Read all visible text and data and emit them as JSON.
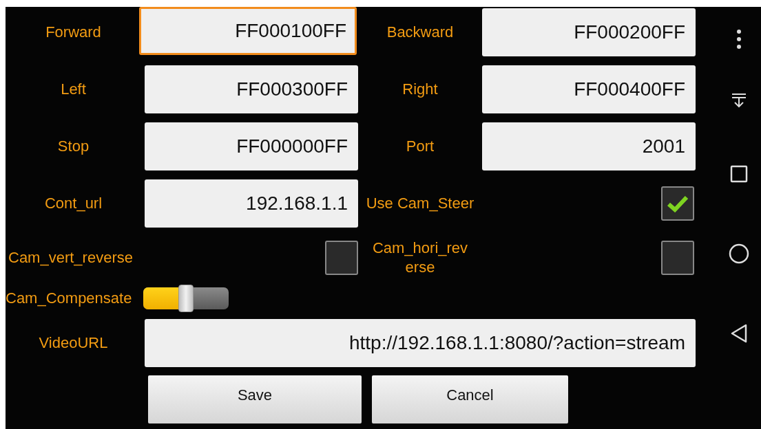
{
  "settings": [
    {
      "kind": "text",
      "label": "Forward",
      "value": "FF000100FF",
      "focused": true
    },
    {
      "kind": "text",
      "label": "Backward",
      "value": "FF000200FF",
      "focused": false
    },
    {
      "kind": "text",
      "label": "Left",
      "value": "FF000300FF",
      "focused": false
    },
    {
      "kind": "text",
      "label": "Right",
      "value": "FF000400FF",
      "focused": false
    },
    {
      "kind": "text",
      "label": "Stop",
      "value": "FF000000FF",
      "focused": false
    },
    {
      "kind": "text",
      "label": "Port",
      "value": "2001",
      "focused": false
    },
    {
      "kind": "text",
      "label": "Cont_url",
      "value": "192.168.1.1",
      "focused": false
    },
    {
      "kind": "checkbox",
      "label": "Use Cam_Steer",
      "checked": true
    },
    {
      "kind": "checkbox",
      "label": "Cam_vert_reverse",
      "checked": false
    },
    {
      "kind": "checkbox",
      "label": "Cam_hori_reverse",
      "checked": false
    }
  ],
  "slider": {
    "label": "Cam_Compensate",
    "level": 0.5
  },
  "video_url": {
    "label": "VideoURL",
    "value": "http://192.168.1.1:8080/?action=stream"
  },
  "buttons": [
    "Save",
    "Cancel"
  ]
}
